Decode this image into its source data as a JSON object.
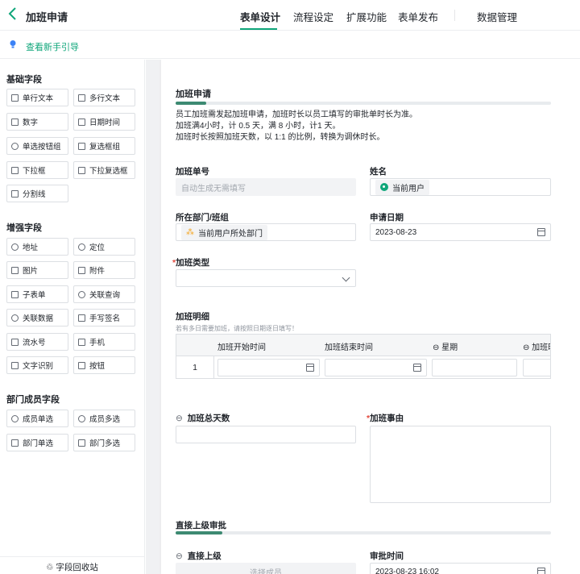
{
  "header": {
    "title": "加班申请",
    "tabs": [
      "表单设计",
      "流程设定",
      "扩展功能",
      "表单发布"
    ],
    "data_mgmt": "数据管理",
    "active_tab": "表单设计"
  },
  "guide": {
    "label": "查看新手引导"
  },
  "sidebar": {
    "basic_title": "基础字段",
    "basic": [
      "单行文本",
      "多行文本",
      "数字",
      "日期时间",
      "单选按钮组",
      "复选框组",
      "下拉框",
      "下拉复选框",
      "分割线"
    ],
    "enhanced_title": "增强字段",
    "enhanced": [
      "地址",
      "定位",
      "图片",
      "附件",
      "子表单",
      "关联查询",
      "关联数据",
      "手写签名",
      "流水号",
      "手机",
      "文字识别",
      "按钮"
    ],
    "dept_title": "部门成员字段",
    "dept": [
      "成员单选",
      "成员多选",
      "部门单选",
      "部门多选"
    ],
    "recycle": "字段回收站"
  },
  "form": {
    "title": "加班申请",
    "description": [
      "员工加班需发起加班申请，加班时长以员工填写的审批单时长为准。",
      "加班满4小时，计 0.5 天，满 8 小时，计1 天。",
      "加班时长按照加班天数，以 1:1 的比例，转换为调休时长。"
    ],
    "order_no": {
      "label": "加班单号",
      "placeholder": "自动生成无需填写"
    },
    "name": {
      "label": "姓名",
      "value": "当前用户"
    },
    "dept": {
      "label": "所在部门/班组",
      "value": "当前用户所处部门"
    },
    "apply_date": {
      "label": "申请日期",
      "value": "2023-08-23"
    },
    "ot_type": {
      "label": "加班类型",
      "required": "*"
    },
    "detail": {
      "label": "加班明细",
      "hint": "若有多日需要加班，请按照日期逐日填写！",
      "columns": [
        "加班开始时间",
        "加班结束时间",
        "星期",
        "加班时"
      ],
      "row_no": "1"
    },
    "total_days": {
      "label": "加班总天数"
    },
    "reason": {
      "label": "加班事由",
      "required": "*"
    },
    "approval": {
      "title": "直接上级审批",
      "superior_label": "直接上级",
      "superior_placeholder": "选择成员",
      "time_label": "审批时间",
      "time_value": "2023-08-23 16:02"
    }
  }
}
